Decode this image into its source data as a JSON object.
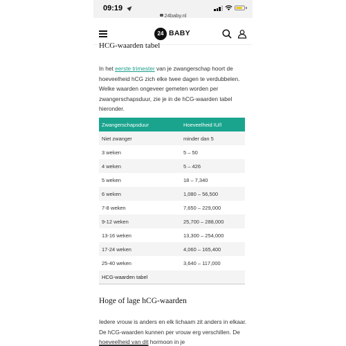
{
  "status_bar": {
    "time": "09:19",
    "url": "24baby.nl"
  },
  "header": {
    "logo_number": "24",
    "logo_text": "BABY"
  },
  "article": {
    "heading_top": "HCG-waarden tabel",
    "intro_before_link": "In het ",
    "intro_link": "eerste trimester",
    "intro_after_link": " van je zwangerschap hoort de hoeveelheid hCG zich elke twee dagen te verdubbelen. Welke waarden ongeveer gemeten worden per zwangerschapsduur, zie je in de hCG-waarden tabel hieronder.",
    "table": {
      "headers": [
        "Zwangerschapsduur",
        "Hoeveelheid IU/l"
      ],
      "rows": [
        [
          "Niet zwanger",
          "minder dan 5"
        ],
        [
          "3 weken",
          "5 – 50"
        ],
        [
          "4 weken",
          "5 – 426"
        ],
        [
          "5 weken",
          "18 – 7,340"
        ],
        [
          "6 weken",
          "1,080 – 56,500"
        ],
        [
          "7-8 weken",
          "7,650 – 229,000"
        ],
        [
          "9-12 weken",
          "25,700 – 288,000"
        ],
        [
          "13-16 weken",
          "13,300 – 254,000"
        ],
        [
          "17-24 weken",
          "4,060 – 165,400"
        ],
        [
          "25-40 weken",
          "3,640 – 117,000"
        ]
      ],
      "caption": "HCG-waarden tabel"
    },
    "heading_bottom": "Hoge of lage hCG-waarden",
    "para2_before": "Iedere vrouw is anders en elk lichaam zit anders in elkaar. De hCG-waarden kunnen per vrouw erg verschillen. De ",
    "para2_underlined": "hoeveelheid van dit",
    "para2_after": " hormoon in je"
  },
  "colors": {
    "accent": "#1aa48e",
    "link": "#1a9e8a",
    "battery": "#f0c419"
  }
}
